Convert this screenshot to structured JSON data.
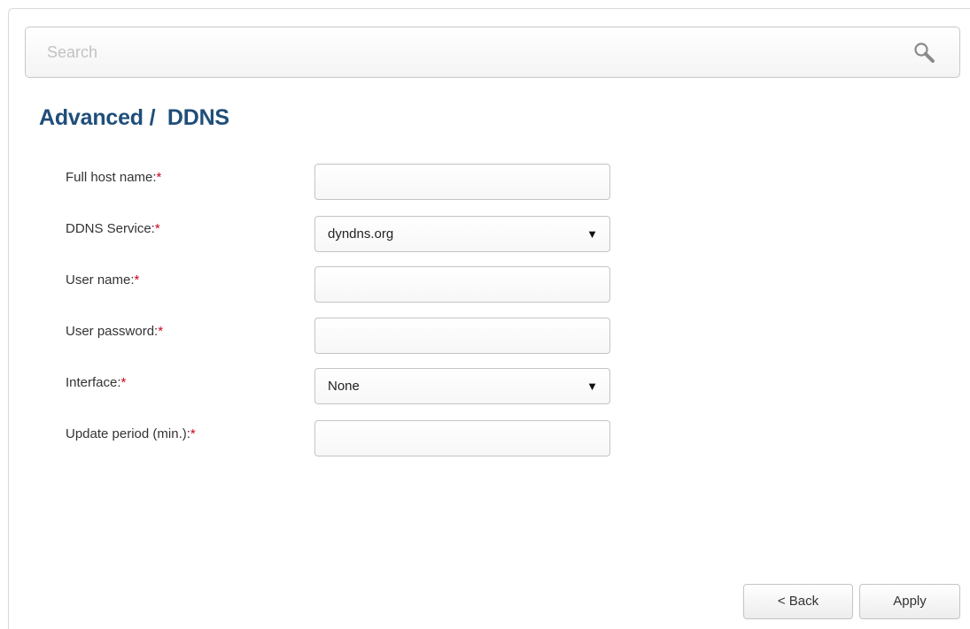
{
  "search": {
    "placeholder": "Search",
    "icon": "search-icon"
  },
  "page": {
    "title": "Advanced /  DDNS"
  },
  "form": {
    "required_marker": "*",
    "fields": {
      "full_host_name": {
        "label": "Full host name:",
        "value": ""
      },
      "ddns_service": {
        "label": "DDNS Service:",
        "value": "dyndns.org",
        "arrow": "▼"
      },
      "user_name": {
        "label": "User name:",
        "value": ""
      },
      "user_password": {
        "label": "User password:",
        "value": ""
      },
      "interface": {
        "label": "Interface:",
        "value": "None",
        "arrow": "▼"
      },
      "update_period": {
        "label": "Update period (min.):",
        "value": ""
      }
    }
  },
  "buttons": {
    "back": "< Back",
    "apply": "Apply"
  },
  "colors": {
    "title": "#1f4e79",
    "required": "#d0021b"
  }
}
